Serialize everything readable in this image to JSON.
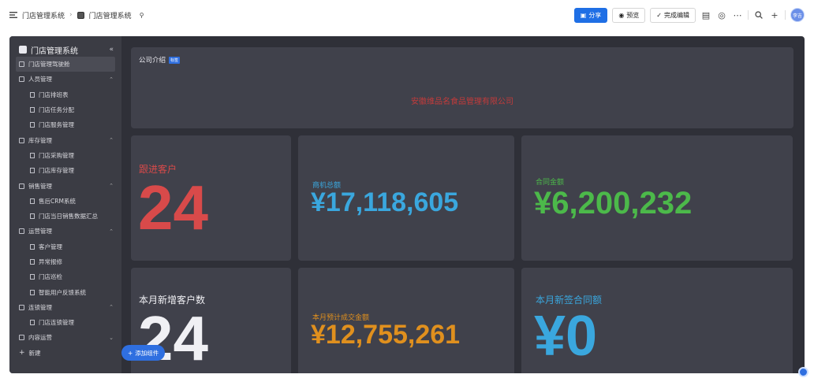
{
  "topbar": {
    "crumb_parent": "门店管理系统",
    "crumb_current": "门店管理系统",
    "share_label": "分享",
    "preview_label": "预览",
    "finish_label": "完成编辑",
    "avatar_text": "李吉"
  },
  "sidebar": {
    "title": "门店管理系统",
    "items": [
      {
        "label": "门店管理驾驶舱",
        "level": "top",
        "active": true
      },
      {
        "label": "人员管理",
        "level": "group"
      },
      {
        "label": "门店排班表",
        "level": "sub"
      },
      {
        "label": "门店任务分配",
        "level": "sub"
      },
      {
        "label": "门店服务管理",
        "level": "sub"
      },
      {
        "label": "库存管理",
        "level": "group"
      },
      {
        "label": "门店采购管理",
        "level": "sub"
      },
      {
        "label": "门店库存管理",
        "level": "sub"
      },
      {
        "label": "销售管理",
        "level": "group"
      },
      {
        "label": "售后CRM系统",
        "level": "sub"
      },
      {
        "label": "门店当日销售数据汇总",
        "level": "sub"
      },
      {
        "label": "运营管理",
        "level": "group"
      },
      {
        "label": "客户管理",
        "level": "sub"
      },
      {
        "label": "异常报修",
        "level": "sub"
      },
      {
        "label": "门店巡检",
        "level": "sub"
      },
      {
        "label": "智能用户反馈系统",
        "level": "sub"
      },
      {
        "label": "连锁管理",
        "level": "group"
      },
      {
        "label": "门店连锁管理",
        "level": "sub"
      },
      {
        "label": "内容运营",
        "level": "group-closed"
      },
      {
        "label": "新建",
        "level": "new"
      }
    ]
  },
  "intro": {
    "title": "公司介绍",
    "badge": "标签",
    "company": "安徽维品名食品管理有限公司"
  },
  "kpis": {
    "follow_label": "跟进客户",
    "follow_value": "24",
    "opportunity_label": "商机总额",
    "opportunity_value": "¥17,118,605",
    "contract_label": "合同金额",
    "contract_value": "¥6,200,232",
    "new_customers_label": "本月新增客户数",
    "new_customers_value": "24",
    "forecast_label": "本月预计成交金额",
    "forecast_value": "¥12,755,261",
    "new_contract_label": "本月新签合同额",
    "new_contract_value": "¥0"
  },
  "add_component_label": "添加组件",
  "colors": {
    "red": "#d84a4a",
    "blue": "#3aa7de",
    "green": "#4cb94a",
    "orange": "#e0901e",
    "white": "#f0f0f4"
  }
}
